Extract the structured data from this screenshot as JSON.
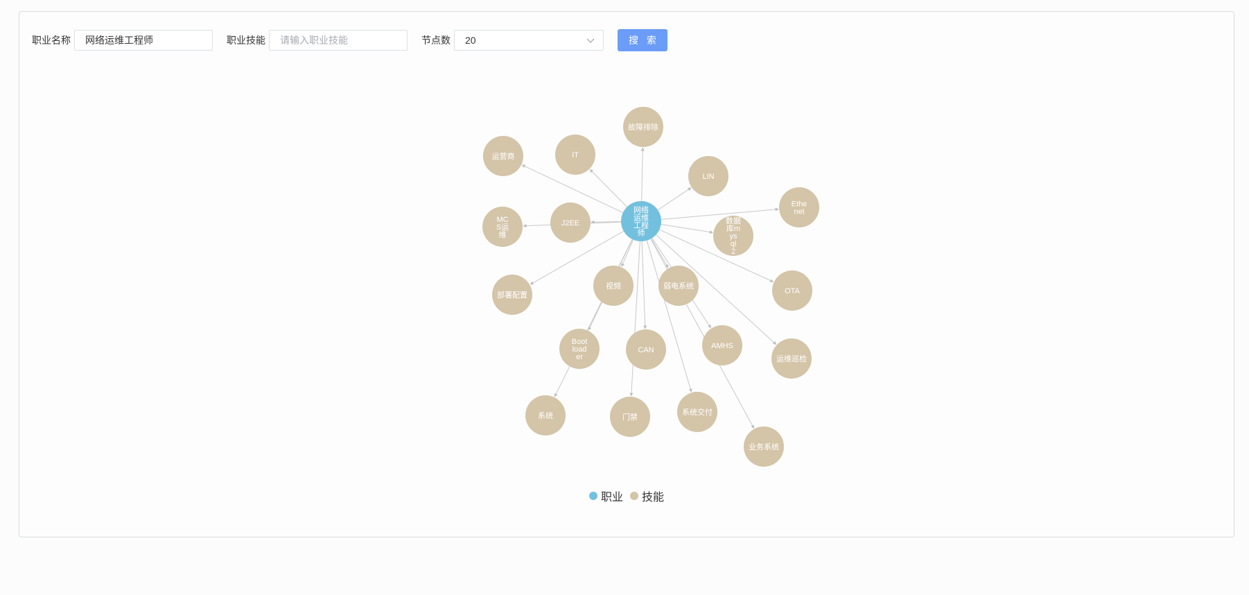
{
  "search": {
    "job_label": "职业名称",
    "job_value": "网络运维工程师",
    "skill_label": "职业技能",
    "skill_placeholder": "请输入职业技能",
    "node_count_label": "节点数",
    "node_count_value": "20",
    "button_label": "搜 索"
  },
  "legend": {
    "job": "职业",
    "skill": "技能"
  },
  "colors": {
    "job_node": "#73c0de",
    "skill_node": "#d4c4a8",
    "edge": "#c8c8c8",
    "accent": "#6a9cf8"
  },
  "graph": {
    "center": {
      "id": "center",
      "label": "网络运维工程师",
      "category": "job"
    },
    "nodes": [
      {
        "id": "gzpc",
        "label": "故障排除",
        "category": "skill"
      },
      {
        "id": "it",
        "label": "IT",
        "category": "skill"
      },
      {
        "id": "yys",
        "label": "运营商",
        "category": "skill"
      },
      {
        "id": "lin",
        "label": "LIN",
        "category": "skill"
      },
      {
        "id": "eth",
        "label": "Ethenet",
        "category": "skill"
      },
      {
        "id": "j2ee",
        "label": "J2EE",
        "category": "skill"
      },
      {
        "id": "mcs",
        "label": "MCS运维",
        "category": "skill"
      },
      {
        "id": "mysql",
        "label": "数据库mysql2",
        "category": "skill"
      },
      {
        "id": "bspz",
        "label": "部署配置",
        "category": "skill"
      },
      {
        "id": "sp",
        "label": "视频",
        "category": "skill"
      },
      {
        "id": "rdxt",
        "label": "弱电系统",
        "category": "skill"
      },
      {
        "id": "ota",
        "label": "OTA",
        "category": "skill"
      },
      {
        "id": "boot",
        "label": "Bootloader",
        "category": "skill"
      },
      {
        "id": "can",
        "label": "CAN",
        "category": "skill"
      },
      {
        "id": "amhs",
        "label": "AMHS",
        "category": "skill"
      },
      {
        "id": "ywxj",
        "label": "运维巡检",
        "category": "skill"
      },
      {
        "id": "xt",
        "label": "系统",
        "category": "skill"
      },
      {
        "id": "mj",
        "label": "门禁",
        "category": "skill"
      },
      {
        "id": "xtjf",
        "label": "系统交付",
        "category": "skill"
      },
      {
        "id": "ywxt",
        "label": "业务系统",
        "category": "skill"
      }
    ],
    "edges": [
      [
        "center",
        "gzpc"
      ],
      [
        "center",
        "it"
      ],
      [
        "center",
        "yys"
      ],
      [
        "center",
        "lin"
      ],
      [
        "center",
        "eth"
      ],
      [
        "center",
        "j2ee"
      ],
      [
        "center",
        "mcs"
      ],
      [
        "center",
        "mysql"
      ],
      [
        "center",
        "bspz"
      ],
      [
        "center",
        "sp"
      ],
      [
        "center",
        "rdxt"
      ],
      [
        "center",
        "ota"
      ],
      [
        "center",
        "boot"
      ],
      [
        "center",
        "can"
      ],
      [
        "center",
        "amhs"
      ],
      [
        "center",
        "ywxj"
      ],
      [
        "center",
        "xt"
      ],
      [
        "center",
        "mj"
      ],
      [
        "center",
        "xtjf"
      ],
      [
        "center",
        "ywxt"
      ]
    ]
  }
}
